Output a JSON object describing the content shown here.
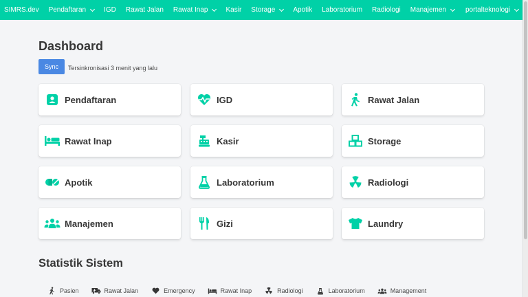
{
  "colors": {
    "accent": "#00d1a7",
    "sync": "#4a88e3"
  },
  "nav": {
    "brand": "SIMRS.dev",
    "items": [
      {
        "label": "Pendaftaran",
        "dropdown": true
      },
      {
        "label": "IGD",
        "dropdown": false
      },
      {
        "label": "Rawat Jalan",
        "dropdown": false
      },
      {
        "label": "Rawat Inap",
        "dropdown": true
      },
      {
        "label": "Kasir",
        "dropdown": false
      },
      {
        "label": "Storage",
        "dropdown": true
      },
      {
        "label": "Apotik",
        "dropdown": false
      },
      {
        "label": "Laboratorium",
        "dropdown": false
      },
      {
        "label": "Radiologi",
        "dropdown": false
      },
      {
        "label": "Manajemen",
        "dropdown": true
      }
    ],
    "user": "portalteknologi"
  },
  "page": {
    "title": "Dashboard",
    "sync_label": "Sync",
    "sync_status": "Tersinkronisasi 3 menit yang lalu"
  },
  "modules": [
    {
      "label": "Pendaftaran",
      "icon": "id-card-icon"
    },
    {
      "label": "IGD",
      "icon": "heartbeat-icon"
    },
    {
      "label": "Rawat Jalan",
      "icon": "walking-icon"
    },
    {
      "label": "Rawat Inap",
      "icon": "bed-icon"
    },
    {
      "label": "Kasir",
      "icon": "cash-register-icon"
    },
    {
      "label": "Storage",
      "icon": "boxes-icon"
    },
    {
      "label": "Apotik",
      "icon": "pills-icon"
    },
    {
      "label": "Laboratorium",
      "icon": "flask-icon"
    },
    {
      "label": "Radiologi",
      "icon": "radiation-icon"
    },
    {
      "label": "Manajemen",
      "icon": "users-icon"
    },
    {
      "label": "Gizi",
      "icon": "utensils-icon"
    },
    {
      "label": "Laundry",
      "icon": "tshirt-icon"
    }
  ],
  "stats": {
    "title": "Statistik Sistem",
    "tabs": [
      {
        "label": "Pasien",
        "icon": "walking-icon"
      },
      {
        "label": "Rawat Jalan",
        "icon": "ambulance-icon"
      },
      {
        "label": "Emergency",
        "icon": "heart-icon"
      },
      {
        "label": "Rawat Inap",
        "icon": "bed-icon"
      },
      {
        "label": "Radiologi",
        "icon": "radiation-icon"
      },
      {
        "label": "Laboratorium",
        "icon": "flask-icon"
      },
      {
        "label": "Management",
        "icon": "users-icon"
      }
    ]
  }
}
